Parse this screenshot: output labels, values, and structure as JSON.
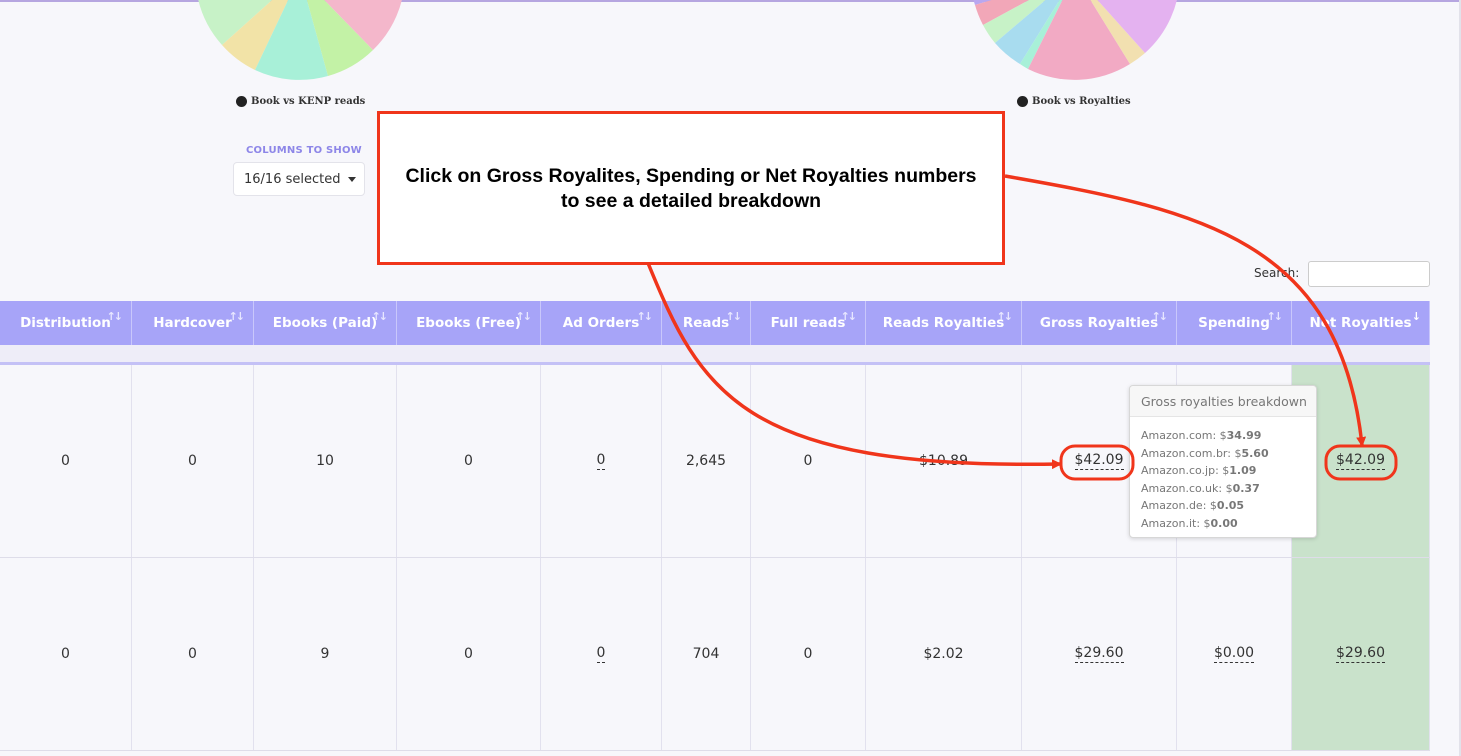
{
  "charts": [
    {
      "legend": "Book vs KENP reads",
      "slices": [
        {
          "color": "#c7f2c7"
        },
        {
          "color": "#f2e3a7"
        },
        {
          "color": "#a8f0d8"
        },
        {
          "color": "#c3f2a6"
        },
        {
          "color": "#f4b7cb"
        }
      ]
    },
    {
      "legend": "Book vs Royalties",
      "slices": [
        {
          "color": "#b9a7f0"
        },
        {
          "color": "#f2a7b8"
        },
        {
          "color": "#c7f2c7"
        },
        {
          "color": "#a8dcef"
        },
        {
          "color": "#a8f0d8"
        },
        {
          "color": "#f2aac4"
        },
        {
          "color": "#f2e0b0"
        },
        {
          "color": "#e4b2f0"
        }
      ]
    }
  ],
  "columns_picker": {
    "label": "COLUMNS TO SHOW",
    "value": "16/16 selected"
  },
  "search": {
    "label": "Search:",
    "value": ""
  },
  "table": {
    "headers": [
      "Distribution",
      "Hardcover",
      "Ebooks (Paid)",
      "Ebooks (Free)",
      "Ad Orders",
      "Reads",
      "Full reads",
      "Reads Royalties",
      "Gross Royalties",
      "Spending",
      "Net Royalties"
    ],
    "sort_icon": "↑↓",
    "sort_active_icon": "↓",
    "rows": [
      [
        "0",
        "0",
        "10",
        "0",
        "0",
        "2,645",
        "0",
        "$10.89",
        "$42.09",
        "",
        "$42.09"
      ],
      [
        "0",
        "0",
        "9",
        "0",
        "0",
        "704",
        "0",
        "$2.02",
        "$29.60",
        "$0.00",
        "$29.60"
      ]
    ]
  },
  "tooltip": {
    "title": "Gross royalties breakdown",
    "lines": [
      {
        "market": "Amazon.com:",
        "currency": "$",
        "amount": "34.99"
      },
      {
        "market": "Amazon.com.br:",
        "currency": "$",
        "amount": "5.60"
      },
      {
        "market": "Amazon.co.jp:",
        "currency": "$",
        "amount": "1.09"
      },
      {
        "market": "Amazon.co.uk:",
        "currency": "$",
        "amount": "0.37"
      },
      {
        "market": "Amazon.de:",
        "currency": "$",
        "amount": "0.05"
      },
      {
        "market": "Amazon.it:",
        "currency": "$",
        "amount": "0.00"
      }
    ]
  },
  "callout": {
    "line1": "Click on Gross Royalites, Spending or Net Royalties numbers",
    "line2": "to see a detailed breakdown",
    "color": "#f0351b"
  },
  "colors": {
    "header_bg": "#a7a4f8",
    "net_column_bg": "#c9e2cb",
    "accent": "#8d86e8"
  }
}
